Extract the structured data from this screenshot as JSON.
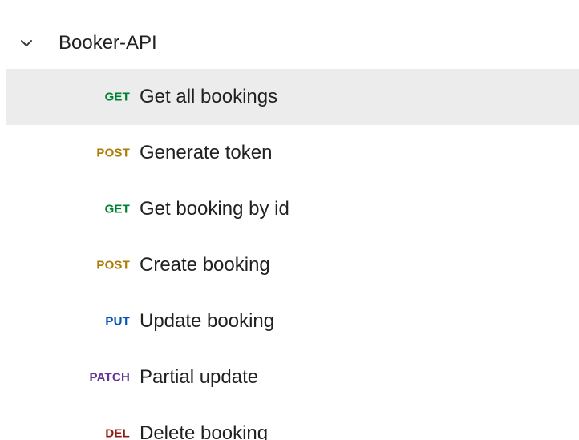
{
  "collection": {
    "name": "Booker-API",
    "chevron_icon": "chevron-down-icon"
  },
  "colors": {
    "GET": "#007f31",
    "POST": "#ad7a03",
    "PUT": "#0053b8",
    "PATCH": "#623497",
    "DEL": "#8e1a10",
    "selected_bg": "#ececec"
  },
  "requests": [
    {
      "method": "GET",
      "name": "Get all bookings",
      "selected": true
    },
    {
      "method": "POST",
      "name": "Generate token",
      "selected": false
    },
    {
      "method": "GET",
      "name": "Get booking by id",
      "selected": false
    },
    {
      "method": "POST",
      "name": "Create booking",
      "selected": false
    },
    {
      "method": "PUT",
      "name": "Update booking",
      "selected": false
    },
    {
      "method": "PATCH",
      "name": "Partial update",
      "selected": false
    },
    {
      "method": "DEL",
      "name": "Delete booking",
      "selected": false
    }
  ]
}
